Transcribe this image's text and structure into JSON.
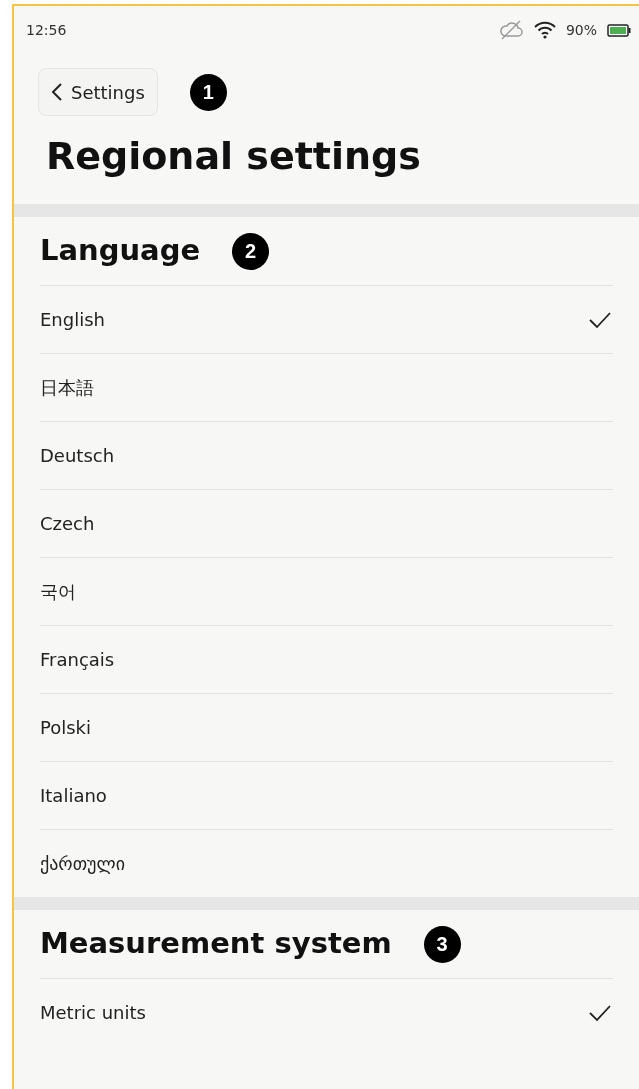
{
  "status_bar": {
    "time": "12:56",
    "battery_text": "90%"
  },
  "back_button": {
    "label": "Settings"
  },
  "title": "Regional settings",
  "sections": [
    {
      "heading": "Language",
      "marker": "2",
      "items": [
        {
          "label": "English",
          "selected": true
        },
        {
          "label": "日本語",
          "selected": false
        },
        {
          "label": "Deutsch",
          "selected": false
        },
        {
          "label": "Czech",
          "selected": false
        },
        {
          "label": "국어",
          "selected": false
        },
        {
          "label": "Français",
          "selected": false
        },
        {
          "label": "Polski",
          "selected": false
        },
        {
          "label": "Italiano",
          "selected": false
        },
        {
          "label": "ქართული",
          "selected": false
        }
      ]
    },
    {
      "heading": "Measurement system",
      "marker": "3",
      "items": [
        {
          "label": "Metric units",
          "selected": true
        }
      ]
    }
  ],
  "header_marker": "1"
}
